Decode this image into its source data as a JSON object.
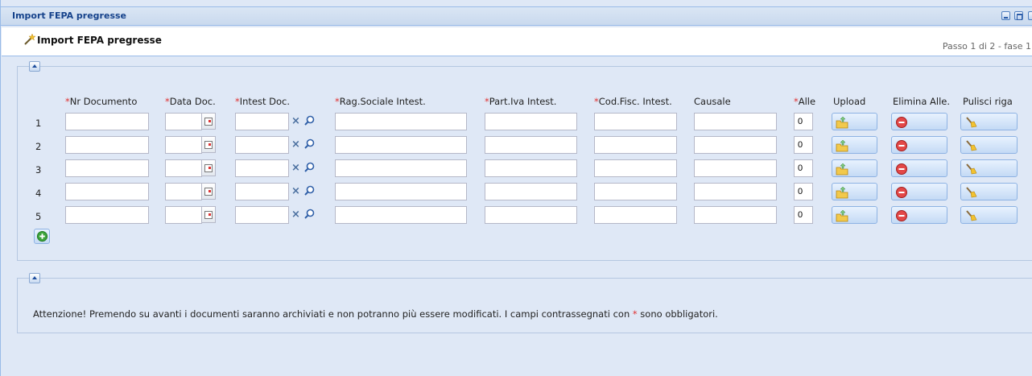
{
  "window": {
    "title": "Import FEPA pregresse"
  },
  "header": {
    "title": "Import FEPA pregresse",
    "step": "Passo 1 di 2 - fase 1"
  },
  "columns": [
    {
      "label": "Nr Documento",
      "required": true
    },
    {
      "label": "Data Doc.",
      "required": true
    },
    {
      "label": "Intest Doc.",
      "required": true
    },
    {
      "label": "Rag.Sociale Intest.",
      "required": true
    },
    {
      "label": "Part.Iva Intest.",
      "required": true
    },
    {
      "label": "Cod.Fisc. Intest.",
      "required": true
    },
    {
      "label": "Causale",
      "required": false
    },
    {
      "label": "Alle",
      "required": true
    },
    {
      "label": "Upload",
      "required": false
    },
    {
      "label": "Elimina Alle.",
      "required": false
    },
    {
      "label": "Pulisci riga",
      "required": false
    }
  ],
  "required_mark": "*",
  "rows": [
    {
      "num": "1",
      "nr_documento": "",
      "data_doc": "",
      "intest_doc": "",
      "rag_sociale": "",
      "part_iva": "",
      "cod_fisc": "",
      "causale": "",
      "alle": "0"
    },
    {
      "num": "2",
      "nr_documento": "",
      "data_doc": "",
      "intest_doc": "",
      "rag_sociale": "",
      "part_iva": "",
      "cod_fisc": "",
      "causale": "",
      "alle": "0"
    },
    {
      "num": "3",
      "nr_documento": "",
      "data_doc": "",
      "intest_doc": "",
      "rag_sociale": "",
      "part_iva": "",
      "cod_fisc": "",
      "causale": "",
      "alle": "0"
    },
    {
      "num": "4",
      "nr_documento": "",
      "data_doc": "",
      "intest_doc": "",
      "rag_sociale": "",
      "part_iva": "",
      "cod_fisc": "",
      "causale": "",
      "alle": "0"
    },
    {
      "num": "5",
      "nr_documento": "",
      "data_doc": "",
      "intest_doc": "",
      "rag_sociale": "",
      "part_iva": "",
      "cod_fisc": "",
      "causale": "",
      "alle": "0"
    }
  ],
  "notice": {
    "before": "Attenzione! Premendo su avanti i documenti saranno archiviati e non potranno più essere modificati. I campi contrassegnati con ",
    "mark": "*",
    "after": " sono obbligatori."
  },
  "colors": {
    "title": "#15428b",
    "panel": "#dfe8f6",
    "border": "#99bbe8",
    "required": "#e03030"
  },
  "icons": {
    "header": "magic-wand-icon",
    "upload": "upload-folder-icon",
    "delete": "delete-red-icon",
    "clear": "broom-icon",
    "add": "add-green-icon",
    "calendar": "calendar-icon",
    "clear_field": "x-icon",
    "search": "magnifier-icon"
  }
}
